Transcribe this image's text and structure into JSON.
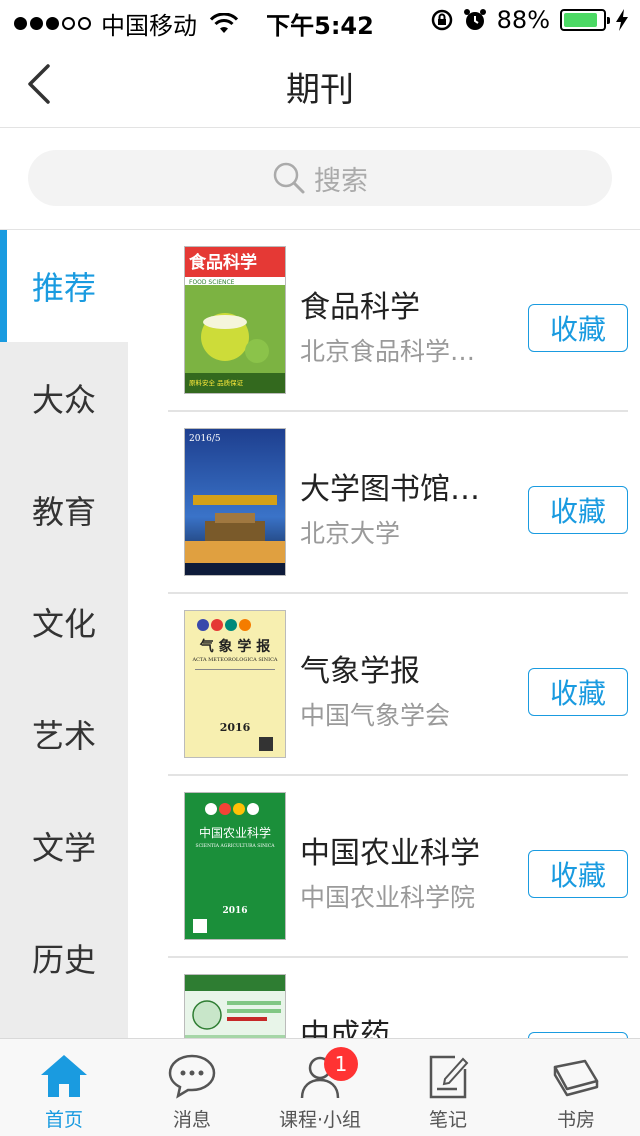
{
  "status_bar": {
    "carrier": "中国移动",
    "time": "下午5:42",
    "battery_percent": "88%",
    "battery_level": 0.88
  },
  "nav": {
    "title": "期刊"
  },
  "search": {
    "placeholder": "搜索"
  },
  "sidebar": {
    "items": [
      {
        "label": "推荐",
        "active": true
      },
      {
        "label": "大众",
        "active": false
      },
      {
        "label": "教育",
        "active": false
      },
      {
        "label": "文化",
        "active": false
      },
      {
        "label": "艺术",
        "active": false
      },
      {
        "label": "文学",
        "active": false
      },
      {
        "label": "历史",
        "active": false
      }
    ]
  },
  "journals": [
    {
      "title": "食品科学",
      "publisher": "北京食品科学研究院",
      "action": "收藏"
    },
    {
      "title": "大学图书馆学报",
      "publisher": "北京大学",
      "action": "收藏"
    },
    {
      "title": "气象学报",
      "publisher": "中国气象学会",
      "action": "收藏"
    },
    {
      "title": "中国农业科学",
      "publisher": "中国农业科学院",
      "action": "收藏"
    },
    {
      "title": "中成药",
      "publisher": "",
      "action": "收藏"
    }
  ],
  "covers": {
    "c0": {
      "masthead": "食品科学",
      "sub": "FOOD SCIENCE",
      "banner": "原料安全 品质保证"
    },
    "c1": {
      "year": "2016/5"
    },
    "c2": {
      "masthead": "气 象 学 报",
      "sub": "ACTA METEOROLOGICA SINICA",
      "year": "2016"
    },
    "c3": {
      "masthead": "中国农业科学",
      "sub": "SCIENTIA AGRICULTURA SINICA",
      "year": "2016"
    }
  },
  "tabbar": {
    "items": [
      {
        "label": "首页",
        "icon": "home-icon",
        "active": true
      },
      {
        "label": "消息",
        "icon": "chat-bubble-icon",
        "active": false
      },
      {
        "label": "课程·小组",
        "icon": "person-icon",
        "active": false,
        "badge": "1"
      },
      {
        "label": "笔记",
        "icon": "note-edit-icon",
        "active": false
      },
      {
        "label": "书房",
        "icon": "books-icon",
        "active": false
      }
    ]
  },
  "colors": {
    "accent": "#1a9be0",
    "badge": "#ff3333",
    "battery": "#4cd964"
  }
}
